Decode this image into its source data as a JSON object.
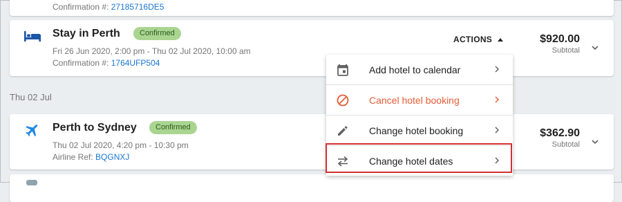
{
  "colors": {
    "page_bg": "#ebeef1",
    "accent_blue": "#1976d2",
    "badge_green": "#a9d591",
    "danger_orange": "#e65c36",
    "highlight_red": "#d32f2f"
  },
  "top_card": {
    "confirmation_label": "Confirmation #:",
    "confirmation_ref": "27185716DE5"
  },
  "hotel_card": {
    "icon": "bed-icon",
    "title": "Stay in Perth",
    "status": "Confirmed",
    "dates": "Fri 26 Jun 2020, 2:00 pm - Thu 02 Jul 2020, 10:00 am",
    "confirmation_label": "Confirmation #:",
    "confirmation_ref": "1764UFP504",
    "actions_label": "ACTIONS",
    "price": "$920.00",
    "price_caption": "Subtotal"
  },
  "date_header": "Thu 02 Jul",
  "flight_card": {
    "icon": "airplane-icon",
    "title": "Perth to Sydney",
    "status": "Confirmed",
    "dates": "Thu 02 Jul 2020, 4:20 pm - 10:30 pm",
    "ref_label": "Airline Ref:",
    "ref_value": "BQGNXJ",
    "price": "$362.90",
    "price_caption": "Subtotal"
  },
  "actions_menu": {
    "items": [
      {
        "label": "Add hotel to calendar",
        "icon": "calendar-icon"
      },
      {
        "label": "Cancel hotel booking",
        "icon": "cancel-icon"
      },
      {
        "label": "Change hotel booking",
        "icon": "pencil-icon"
      },
      {
        "label": "Change hotel dates",
        "icon": "swap-arrows-icon"
      }
    ]
  }
}
